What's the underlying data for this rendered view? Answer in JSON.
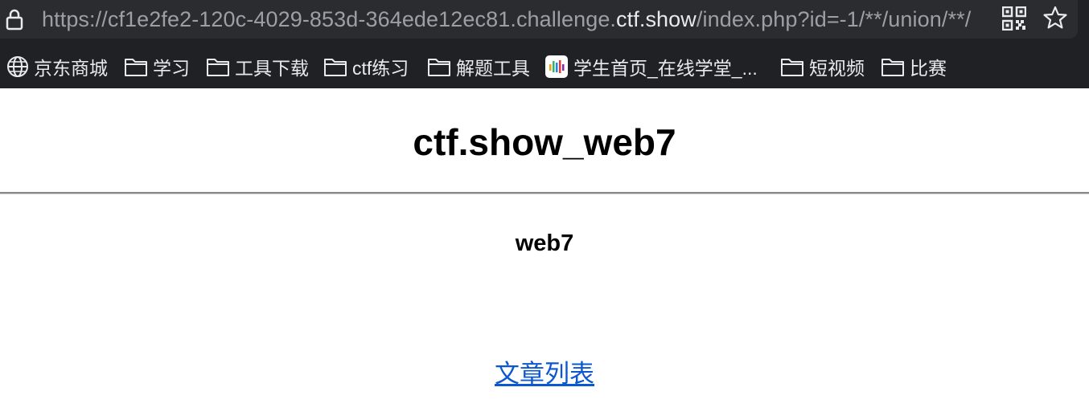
{
  "browser": {
    "url_prefix": "https://cf1e2fe2-120c-4029-853d-364ede12ec81.challenge.",
    "url_host": "ctf.show",
    "url_suffix": "/index.php?id=-1/**/union/**/",
    "bookmarks": [
      {
        "label": "京东商城",
        "icon": "globe-icon"
      },
      {
        "label": "学习",
        "icon": "folder-icon"
      },
      {
        "label": "工具下载",
        "icon": "folder-icon"
      },
      {
        "label": "ctf练习",
        "icon": "folder-icon"
      },
      {
        "label": "解题工具",
        "icon": "folder-icon"
      },
      {
        "label": "学生首页_在线学堂_...",
        "icon": "app-icon"
      },
      {
        "label": "短视频",
        "icon": "folder-icon"
      },
      {
        "label": "比赛",
        "icon": "folder-icon"
      }
    ]
  },
  "page": {
    "title": "ctf.show_web7",
    "subtitle": "web7",
    "link_label": "文章列表"
  },
  "colors": {
    "chrome_bg": "#202124",
    "addressbar_bg": "#2b2c30",
    "link": "#0b57d0"
  }
}
